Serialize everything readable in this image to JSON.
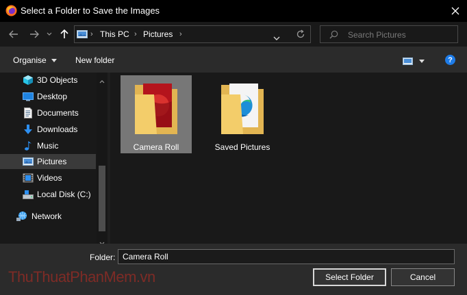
{
  "window": {
    "title": "Select a Folder to Save the Images"
  },
  "address_bar": {
    "segments": [
      "This PC",
      "Pictures"
    ]
  },
  "search": {
    "placeholder": "Search Pictures"
  },
  "toolbar": {
    "organise_label": "Organise",
    "new_folder_label": "New folder",
    "help_label": "?"
  },
  "nav_pane": {
    "items": [
      {
        "label": "3D Objects",
        "icon": "3d-objects-icon"
      },
      {
        "label": "Desktop",
        "icon": "desktop-icon"
      },
      {
        "label": "Documents",
        "icon": "documents-icon"
      },
      {
        "label": "Downloads",
        "icon": "downloads-icon"
      },
      {
        "label": "Music",
        "icon": "music-icon"
      },
      {
        "label": "Pictures",
        "icon": "pictures-icon",
        "selected": true
      },
      {
        "label": "Videos",
        "icon": "videos-icon"
      },
      {
        "label": "Local Disk (C:)",
        "icon": "local-disk-icon"
      },
      {
        "label": "Network",
        "icon": "network-icon"
      }
    ]
  },
  "folders": [
    {
      "label": "Camera Roll",
      "selected": true
    },
    {
      "label": "Saved Pictures",
      "selected": false
    }
  ],
  "footer": {
    "folder_label": "Folder:",
    "folder_value": "Camera Roll",
    "select_button": "Select Folder",
    "cancel_button": "Cancel"
  },
  "watermark": "ThuThuatPhanMem.vn",
  "colors": {
    "titlebar": "#000000",
    "accent": "#1e7ce8",
    "selection": "#777777",
    "folder": "#f3cd6a"
  }
}
